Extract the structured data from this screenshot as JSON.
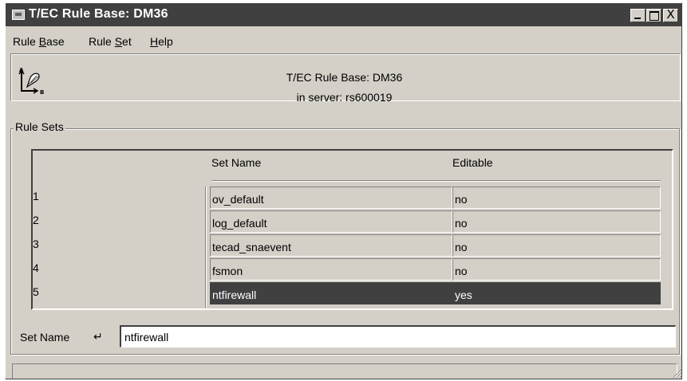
{
  "window": {
    "title": "T/EC Rule Base: DM36",
    "close_glyph": "X"
  },
  "menubar": {
    "items": [
      {
        "pre": "Rule ",
        "key": "B",
        "post": "ase"
      },
      {
        "pre": "Rule ",
        "key": "S",
        "post": "et"
      },
      {
        "pre": "",
        "key": "H",
        "post": "elp"
      }
    ]
  },
  "header": {
    "title": "T/EC Rule Base: DM36",
    "server": "in server: rs600019"
  },
  "rule_sets": {
    "legend": "Rule Sets",
    "columns": {
      "set_name": "Set Name",
      "editable": "Editable"
    },
    "rows": [
      {
        "num": "1",
        "name": "ov_default",
        "editable": "no",
        "selected": false
      },
      {
        "num": "2",
        "name": "log_default",
        "editable": "no",
        "selected": false
      },
      {
        "num": "3",
        "name": "tecad_snaevent",
        "editable": "no",
        "selected": false
      },
      {
        "num": "4",
        "name": "fsmon",
        "editable": "no",
        "selected": false
      },
      {
        "num": "5",
        "name": "ntfirewall",
        "editable": "yes",
        "selected": true
      }
    ]
  },
  "form": {
    "set_name_label": "Set Name",
    "enter_glyph": "↵",
    "set_name_value": "ntfirewall"
  },
  "status": {
    "text": ""
  },
  "icons": {
    "app": "app-icon",
    "rule-base": "rule-base-icon",
    "resize": "resize-grip-icon"
  }
}
